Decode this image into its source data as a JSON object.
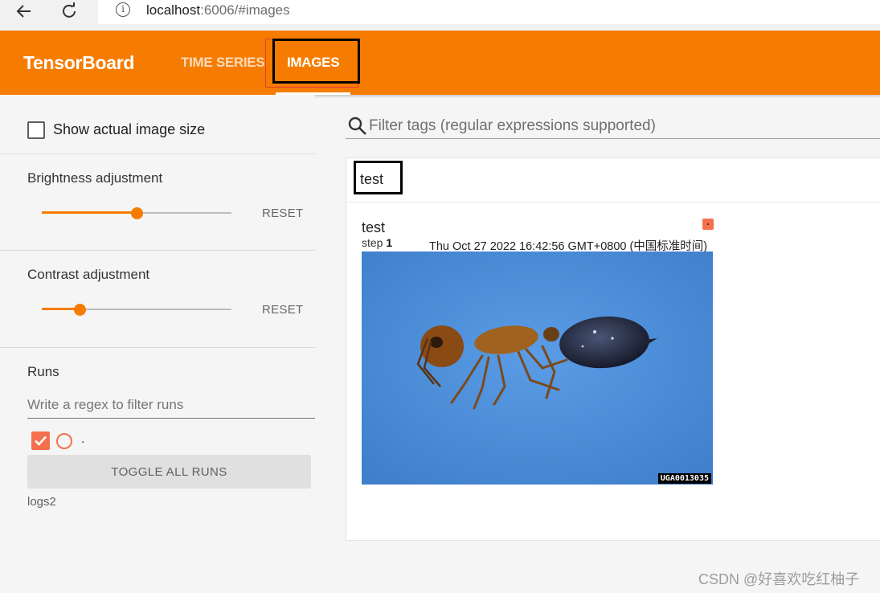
{
  "browser": {
    "url_host": "localhost",
    "url_rest": ":6006/#images",
    "back_icon": "arrow-left-icon",
    "reload_icon": "reload-icon",
    "info_icon": "info-icon"
  },
  "header": {
    "brand": "TensorBoard",
    "tabs": [
      {
        "label": "TIME SERIES",
        "active": false
      },
      {
        "label": "IMAGES",
        "active": true
      }
    ],
    "accent_color": "#f57c00"
  },
  "sidebar": {
    "show_actual_size_label": "Show actual image size",
    "show_actual_size_checked": false,
    "brightness": {
      "title": "Brightness adjustment",
      "reset_label": "RESET",
      "level": 0.5
    },
    "contrast": {
      "title": "Contrast adjustment",
      "reset_label": "RESET",
      "level": 0.2
    },
    "runs": {
      "title": "Runs",
      "filter_placeholder": "Write a regex to filter runs",
      "items": [
        {
          "name": ".",
          "checked": true,
          "color": "#f4704c"
        }
      ],
      "toggle_label": "TOGGLE ALL RUNS",
      "logdir": "logs2"
    }
  },
  "main": {
    "filter_placeholder": "Filter tags (regular expressions supported)",
    "group_title": "test",
    "card": {
      "title": "test",
      "step_label": "step",
      "step_value": "1",
      "timestamp": "Thu Oct 27 2022 16:42:56 GMT+0800 (中国标准时间)",
      "run_color": "#f4704c",
      "image_id": "UGA0013035"
    }
  },
  "watermark": "CSDN @好喜欢吃红柚子"
}
